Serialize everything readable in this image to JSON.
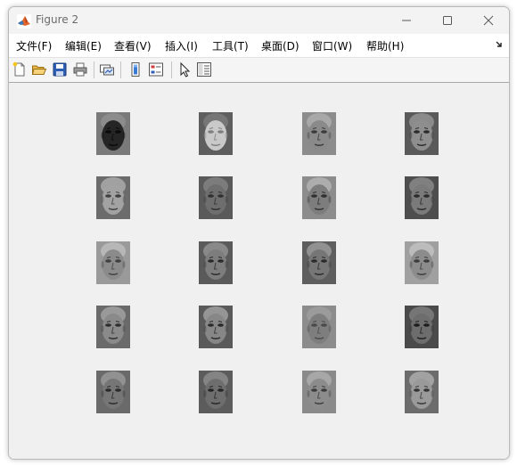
{
  "window": {
    "title": "Figure 2",
    "app_icon": "matlab-logo-icon",
    "controls": [
      "minimize-icon",
      "maximize-icon",
      "close-icon"
    ]
  },
  "menu": {
    "items": [
      "文件(F)",
      "编辑(E)",
      "查看(V)",
      "插入(I)",
      "工具(T)",
      "桌面(D)",
      "窗口(W)",
      "帮助(H)"
    ],
    "corner_icon": "dock-arrow-icon"
  },
  "toolbar": {
    "buttons": [
      "new-figure-icon",
      "open-file-icon",
      "save-icon",
      "print-icon",
      "link-plot-icon",
      "colorbar-icon",
      "legend-icon",
      "edit-plot-arrow-icon",
      "property-inspector-icon"
    ]
  },
  "figure": {
    "rows": 5,
    "cols": 4,
    "images": [
      {
        "bg": "#7a7a7a",
        "face": "#252525",
        "feature": "#0a0a0a",
        "hair": "#9a9a9a"
      },
      {
        "bg": "#5e5e5e",
        "face": "#c9c9c9",
        "feature": "#7f7f7f",
        "hair": "#8a8a8a"
      },
      {
        "bg": "#8c8c8c",
        "face": "#8a8a8a",
        "feature": "#3a3a3a",
        "hair": "#c0c0c0"
      },
      {
        "bg": "#5a5a5a",
        "face": "#8e8e8e",
        "feature": "#2a2a2a",
        "hair": "#b5b5b5"
      },
      {
        "bg": "#6c6c6c",
        "face": "#a2a2a2",
        "feature": "#404040",
        "hair": "#cdcdcd"
      },
      {
        "bg": "#5a5a5a",
        "face": "#6e6e6e",
        "feature": "#303030",
        "hair": "#999999"
      },
      {
        "bg": "#8c8c8c",
        "face": "#7d7d7d",
        "feature": "#303030",
        "hair": "#c8c8c8"
      },
      {
        "bg": "#4e4e4e",
        "face": "#7a7a7a",
        "feature": "#2b2b2b",
        "hair": "#a9a9a9"
      },
      {
        "bg": "#9a9a9a",
        "face": "#8b8b8b",
        "feature": "#404040",
        "hair": "#d0d0d0"
      },
      {
        "bg": "#5a5a5a",
        "face": "#7d7d7d",
        "feature": "#2a2a2a",
        "hair": "#b0b0b0"
      },
      {
        "bg": "#5e5e5e",
        "face": "#767676",
        "feature": "#2a2a2a",
        "hair": "#bcbcbc"
      },
      {
        "bg": "#a0a0a0",
        "face": "#8c8c8c",
        "feature": "#3c3c3c",
        "hair": "#d4d4d4"
      },
      {
        "bg": "#6a6a6a",
        "face": "#8a8a8a",
        "feature": "#2e2e2e",
        "hair": "#c0c0c0"
      },
      {
        "bg": "#5a5a5a",
        "face": "#878787",
        "feature": "#2a2a2a",
        "hair": "#c6c6c6"
      },
      {
        "bg": "#8c8c8c",
        "face": "#7e7e7e",
        "feature": "#4a4a4a",
        "hair": "#a8a8a8"
      },
      {
        "bg": "#4a4a4a",
        "face": "#6d6d6d",
        "feature": "#1e1e1e",
        "hair": "#9a9a9a"
      },
      {
        "bg": "#6a6a6a",
        "face": "#767676",
        "feature": "#2a2a2a",
        "hair": "#b0b0b0"
      },
      {
        "bg": "#5c5c5c",
        "face": "#6e6e6e",
        "feature": "#262626",
        "hair": "#a6a6a6"
      },
      {
        "bg": "#8a8a8a",
        "face": "#8c8c8c",
        "feature": "#3c3c3c",
        "hair": "#c0c0c0"
      },
      {
        "bg": "#6c6c6c",
        "face": "#9a9a9a",
        "feature": "#353535",
        "hair": "#cfcfcf"
      }
    ]
  }
}
